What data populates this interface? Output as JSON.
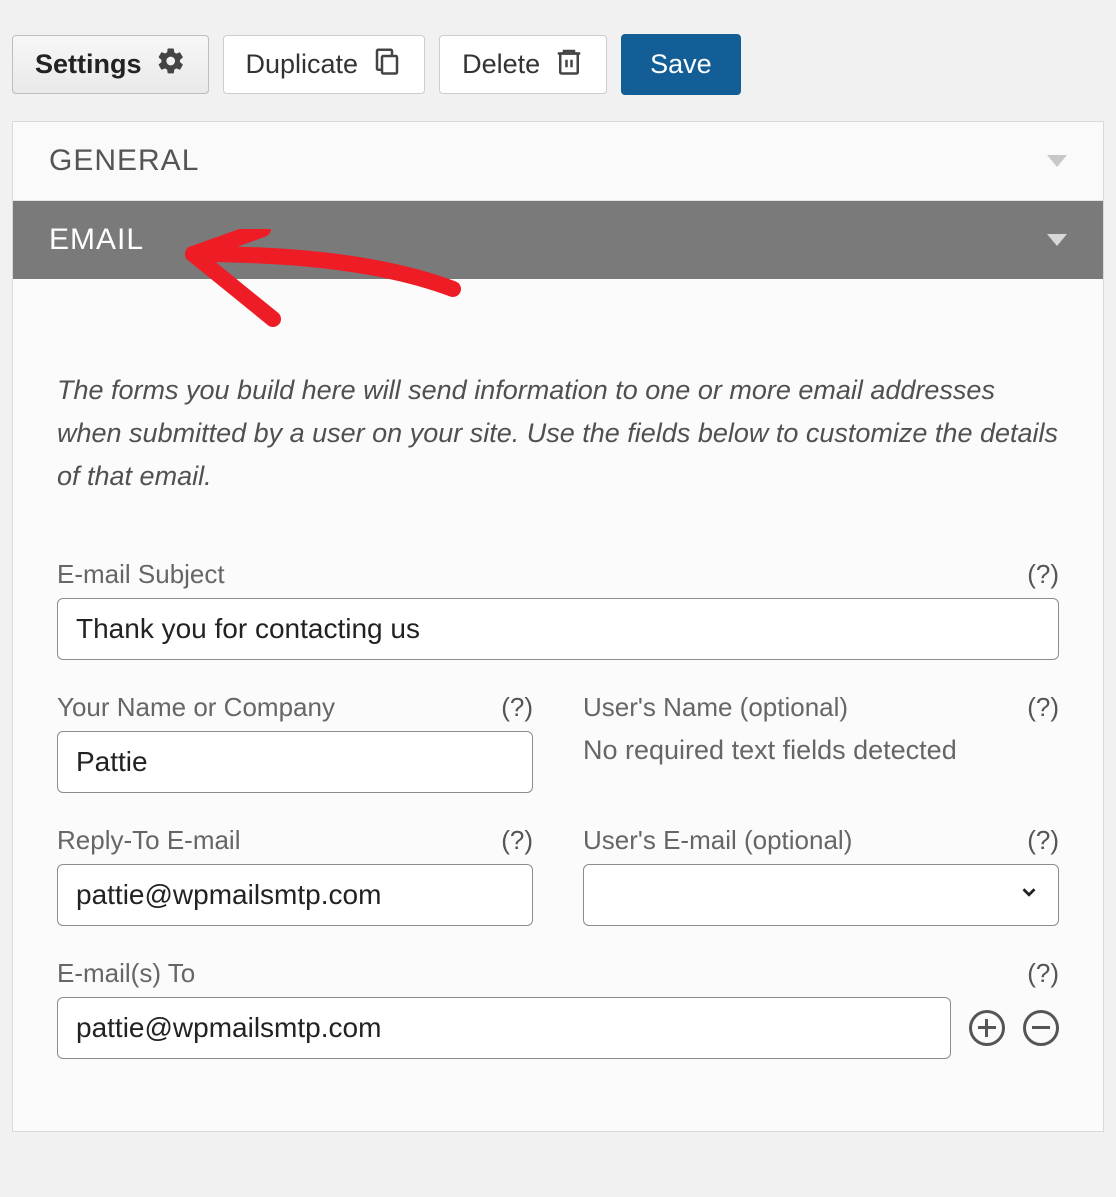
{
  "toolbar": {
    "settings": "Settings",
    "duplicate": "Duplicate",
    "delete": "Delete",
    "save": "Save"
  },
  "sections": {
    "general": {
      "title": "GENERAL"
    },
    "email": {
      "title": "EMAIL",
      "intro": "The forms you build here will send information to one or more email addresses when submitted by a user on your site. Use the fields below to customize the details of that email.",
      "help_glyph": "(?)",
      "fields": {
        "subject": {
          "label": "E-mail Subject",
          "value": "Thank you for contacting us"
        },
        "your_name": {
          "label": "Your Name or Company",
          "value": "Pattie"
        },
        "user_name": {
          "label": "User's Name (optional)",
          "message": "No required text fields detected"
        },
        "reply_to": {
          "label": "Reply-To E-mail",
          "value": "pattie@wpmailsmtp.com"
        },
        "user_email": {
          "label": "User's E-mail (optional)",
          "value": ""
        },
        "emails_to": {
          "label": "E-mail(s) To",
          "value": "pattie@wpmailsmtp.com"
        }
      }
    }
  }
}
